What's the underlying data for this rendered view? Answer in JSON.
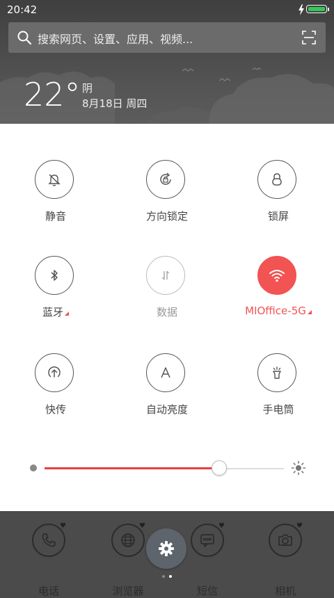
{
  "status": {
    "time": "20:42",
    "battery_color": "#34c759"
  },
  "search": {
    "placeholder": "搜索网页、设置、应用、视频..."
  },
  "weather": {
    "temperature": "22°",
    "condition": "阴",
    "date": "8月18日 周四"
  },
  "toggles": [
    {
      "label": "静音",
      "icon": "bell-off-icon",
      "state": "off"
    },
    {
      "label": "方向锁定",
      "icon": "rotation-lock-icon",
      "state": "off"
    },
    {
      "label": "锁屏",
      "icon": "lock-icon",
      "state": "off"
    },
    {
      "label": "蓝牙",
      "icon": "bluetooth-icon",
      "state": "off",
      "has_settings": true
    },
    {
      "label": "数据",
      "icon": "mobile-data-icon",
      "state": "disabled"
    },
    {
      "label": "MIOffice-5G",
      "icon": "wifi-icon",
      "state": "on",
      "has_settings": true
    },
    {
      "label": "快传",
      "icon": "quick-transfer-icon",
      "state": "off"
    },
    {
      "label": "自动亮度",
      "icon": "auto-brightness-icon",
      "state": "off"
    },
    {
      "label": "手电筒",
      "icon": "flashlight-icon",
      "state": "off"
    }
  ],
  "brightness": {
    "level": 0.73,
    "accent": "#e83d3d"
  },
  "accent_color": "#f25353",
  "dock": {
    "apps": [
      {
        "label": "电话",
        "icon": "phone-icon"
      },
      {
        "label": "浏览器",
        "icon": "globe-icon"
      },
      {
        "label": "短信",
        "icon": "message-icon"
      },
      {
        "label": "相机",
        "icon": "camera-icon"
      }
    ],
    "settings_icon": "gear-icon",
    "page_count": 2,
    "active_page": 1
  }
}
